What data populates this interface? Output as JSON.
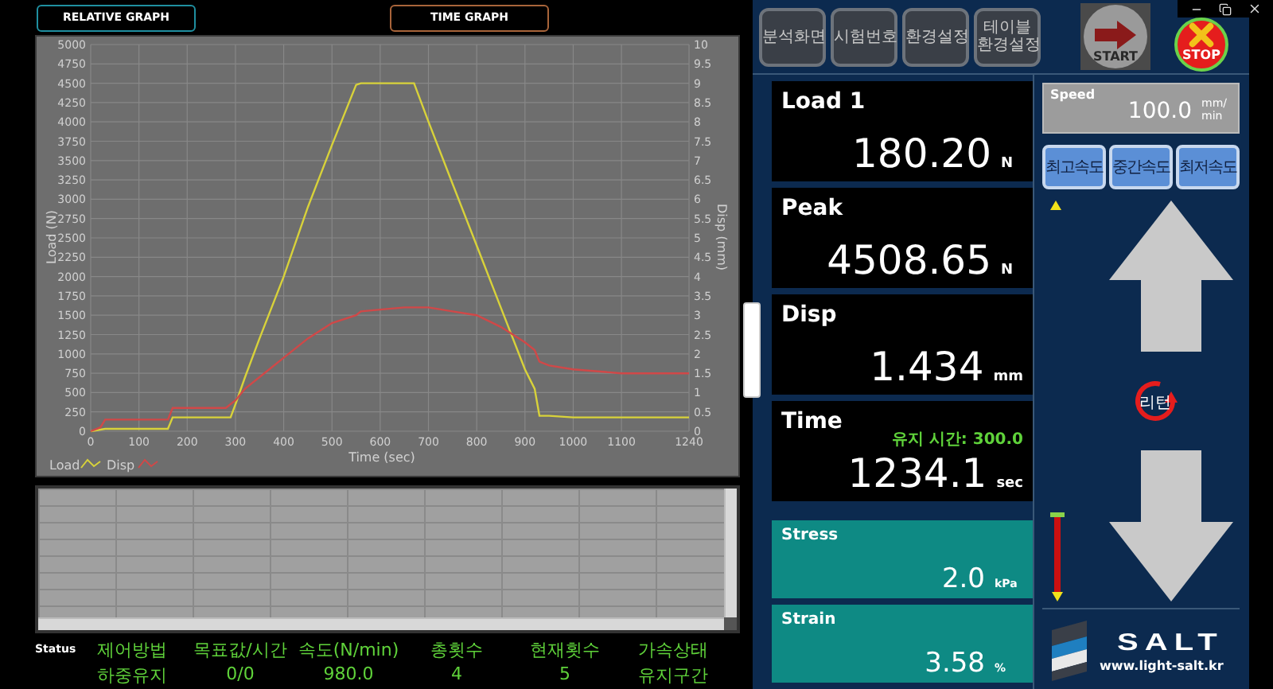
{
  "graph_tabs": [
    {
      "label": "RELATIVE GRAPH",
      "color": "#1f8fa0"
    },
    {
      "label": "TIME GRAPH",
      "color": "#a8643a"
    }
  ],
  "chart": {
    "chart_data": {
      "type": "line",
      "grid": true,
      "legend": "bottom-left",
      "xlabel": "Time (sec)",
      "ylabel": "Load (N)",
      "y2label": "Disp (mm)",
      "xlim": [
        0,
        1240
      ],
      "ylim": [
        0,
        5000
      ],
      "y2lim": [
        0,
        10
      ],
      "xticks": [
        0,
        100,
        200,
        300,
        400,
        500,
        600,
        700,
        800,
        900,
        1000,
        1100,
        1240
      ],
      "yticks": [
        0,
        250,
        500,
        750,
        1000,
        1250,
        1500,
        1750,
        2000,
        2250,
        2500,
        2750,
        3000,
        3250,
        3500,
        3750,
        4000,
        4250,
        4500,
        4750,
        5000
      ],
      "y2ticks": [
        0,
        0.5,
        1,
        1.5,
        2,
        2.5,
        3,
        3.5,
        4,
        4.5,
        5,
        5.5,
        6,
        6.5,
        7,
        7.5,
        8,
        8.5,
        9,
        9.5,
        10
      ],
      "x": [
        0,
        20,
        30,
        150,
        160,
        170,
        280,
        290,
        300,
        320,
        350,
        400,
        450,
        500,
        550,
        560,
        650,
        670,
        700,
        750,
        800,
        850,
        900,
        920,
        930,
        950,
        1000,
        1100,
        1240
      ],
      "series": [
        {
          "name": "Load",
          "color": "#d8d23a",
          "values": [
            0,
            20,
            30,
            30,
            30,
            180,
            180,
            180,
            350,
            700,
            1200,
            2000,
            2900,
            3700,
            4480,
            4500,
            4500,
            4500,
            4000,
            3200,
            2400,
            1600,
            800,
            550,
            200,
            200,
            180,
            180,
            180
          ]
        },
        {
          "name": "Disp",
          "color": "#d04848",
          "axis": "y2",
          "values": [
            0,
            0.1,
            0.3,
            0.3,
            0.3,
            0.6,
            0.6,
            0.7,
            0.8,
            1.1,
            1.4,
            1.9,
            2.4,
            2.8,
            3,
            3.1,
            3.2,
            3.2,
            3.2,
            3.1,
            3,
            2.7,
            2.3,
            2.1,
            1.8,
            1.7,
            1.6,
            1.5,
            1.5
          ]
        }
      ]
    }
  },
  "status": {
    "label": "Status",
    "columns": [
      {
        "header": "제어방법",
        "value": "하중유지"
      },
      {
        "header": "목표값/시간",
        "value": "0/0"
      },
      {
        "header": "속도(N/min)",
        "value": "980.0"
      },
      {
        "header": "총횟수",
        "value": "4"
      },
      {
        "header": "현재횟수",
        "value": "5"
      },
      {
        "header": "가속상태",
        "value": "유지구간"
      }
    ]
  },
  "toolbar": {
    "buttons": [
      {
        "label": "분석화면"
      },
      {
        "label": "시험번호"
      },
      {
        "label": "환경설정"
      },
      {
        "label": "테이블 환경설정"
      }
    ]
  },
  "start_button": {
    "label": "START"
  },
  "stop_button": {
    "label": "STOP"
  },
  "readouts": [
    {
      "kind": "main",
      "label": "Load 1",
      "value": "180.20",
      "unit": "N"
    },
    {
      "kind": "main",
      "label": "Peak",
      "value": "4508.65",
      "unit": "N"
    },
    {
      "kind": "main",
      "label": "Disp",
      "value": "1.434",
      "unit": "mm"
    },
    {
      "kind": "main",
      "label": "Time",
      "note": "유지 시간: 300.0",
      "value": "1234.1",
      "unit": "sec"
    },
    {
      "kind": "teal",
      "label": "Stress",
      "value": "2.0",
      "unit": "kPa"
    },
    {
      "kind": "teal",
      "label": "Strain",
      "value": "3.58",
      "unit": "%"
    }
  ],
  "speed": {
    "label": "Speed",
    "value": "100.0",
    "unit": "mm/min"
  },
  "speed_buttons": [
    {
      "label": "최고속도"
    },
    {
      "label": "중간속도"
    },
    {
      "label": "최저속도"
    }
  ],
  "return_button": {
    "label": "리턴"
  },
  "logo": {
    "name": "SALT",
    "url": "www.light-salt.kr"
  }
}
